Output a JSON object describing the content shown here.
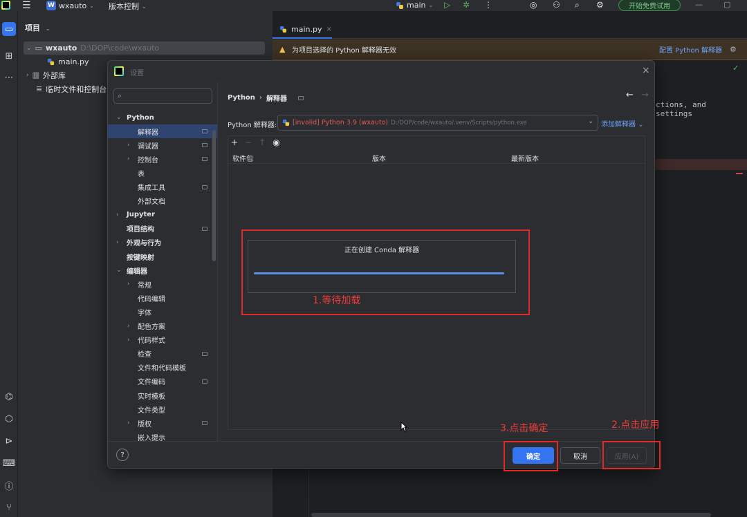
{
  "titlebar": {
    "project_badge": "W",
    "project_name": "wxauto",
    "vcs_label": "版本控制",
    "branch": "main",
    "trial_button": "开始免费试用"
  },
  "project_panel": {
    "header": "项目",
    "root_name": "wxauto",
    "root_path": "D:\\DOP\\code\\wxauto",
    "file_main": "main.py",
    "external_libs": "外部库",
    "scratches": "临时文件和控制台"
  },
  "editor": {
    "tab_name": "main.py",
    "warning_text": "为项目选择的 Python 解释器无效",
    "configure_link": "配置 Python 解释器",
    "code_snippet": "ctions, and settings"
  },
  "dialog": {
    "title": "设置",
    "search_placeholder": "",
    "nav": [
      {
        "label": "Python",
        "level": 0,
        "bold": true,
        "expanded": true,
        "pin": false
      },
      {
        "label": "解释器",
        "level": 1,
        "bold": false,
        "selected": true,
        "pin": true
      },
      {
        "label": "调试器",
        "level": 1,
        "bold": false,
        "collapsed": true,
        "pin": true
      },
      {
        "label": "控制台",
        "level": 1,
        "bold": false,
        "collapsed": true,
        "pin": true
      },
      {
        "label": "表",
        "level": 1,
        "bold": false,
        "pin": false
      },
      {
        "label": "集成工具",
        "level": 1,
        "bold": false,
        "pin": true
      },
      {
        "label": "外部文档",
        "level": 1,
        "bold": false,
        "pin": false
      },
      {
        "label": "Jupyter",
        "level": 0,
        "bold": true,
        "collapsed": true,
        "pin": false
      },
      {
        "label": "项目结构",
        "level": 0,
        "bold": true,
        "pin": true
      },
      {
        "label": "外观与行为",
        "level": 0,
        "bold": true,
        "collapsed": true,
        "pin": false
      },
      {
        "label": "按键映射",
        "level": 0,
        "bold": true,
        "pin": false
      },
      {
        "label": "编辑器",
        "level": 0,
        "bold": true,
        "expanded": true,
        "pin": false
      },
      {
        "label": "常规",
        "level": 1,
        "bold": false,
        "collapsed": true,
        "pin": false
      },
      {
        "label": "代码编辑",
        "level": 1,
        "bold": false,
        "pin": false
      },
      {
        "label": "字体",
        "level": 1,
        "bold": false,
        "pin": false
      },
      {
        "label": "配色方案",
        "level": 1,
        "bold": false,
        "collapsed": true,
        "pin": false
      },
      {
        "label": "代码样式",
        "level": 1,
        "bold": false,
        "collapsed": true,
        "pin": false
      },
      {
        "label": "检查",
        "level": 1,
        "bold": false,
        "pin": true
      },
      {
        "label": "文件和代码模板",
        "level": 1,
        "bold": false,
        "pin": false
      },
      {
        "label": "文件编码",
        "level": 1,
        "bold": false,
        "pin": true
      },
      {
        "label": "实时模板",
        "level": 1,
        "bold": false,
        "pin": false
      },
      {
        "label": "文件类型",
        "level": 1,
        "bold": false,
        "pin": false
      },
      {
        "label": "版权",
        "level": 1,
        "bold": false,
        "collapsed": true,
        "pin": true
      },
      {
        "label": "嵌入提示",
        "level": 1,
        "bold": false,
        "pin": false
      }
    ],
    "breadcrumb_parent": "Python",
    "breadcrumb_current": "解释器",
    "interpreter_label": "Python 解释器:",
    "interpreter_value": "[invalid] Python 3.9 (wxauto)",
    "interpreter_path": "D:/DOP/code/wxauto/.venv/Scripts/python.exe",
    "add_interpreter": "添加解释器",
    "table_headers": [
      "软件包",
      "版本",
      "最新版本"
    ],
    "progress_text": "正在创建 Conda 解释器",
    "ok_button": "确定",
    "cancel_button": "取消",
    "apply_button": "应用(A)",
    "help_button": "?"
  },
  "annotations": {
    "step1": "1.等待加载",
    "step2": "2.点击应用",
    "step3": "3.点击确定"
  },
  "colors": {
    "accent": "#3574f0",
    "annotation_red": "#e02a2a",
    "invalid_red": "#e35a5a",
    "warning_bg": "#3d3223"
  }
}
